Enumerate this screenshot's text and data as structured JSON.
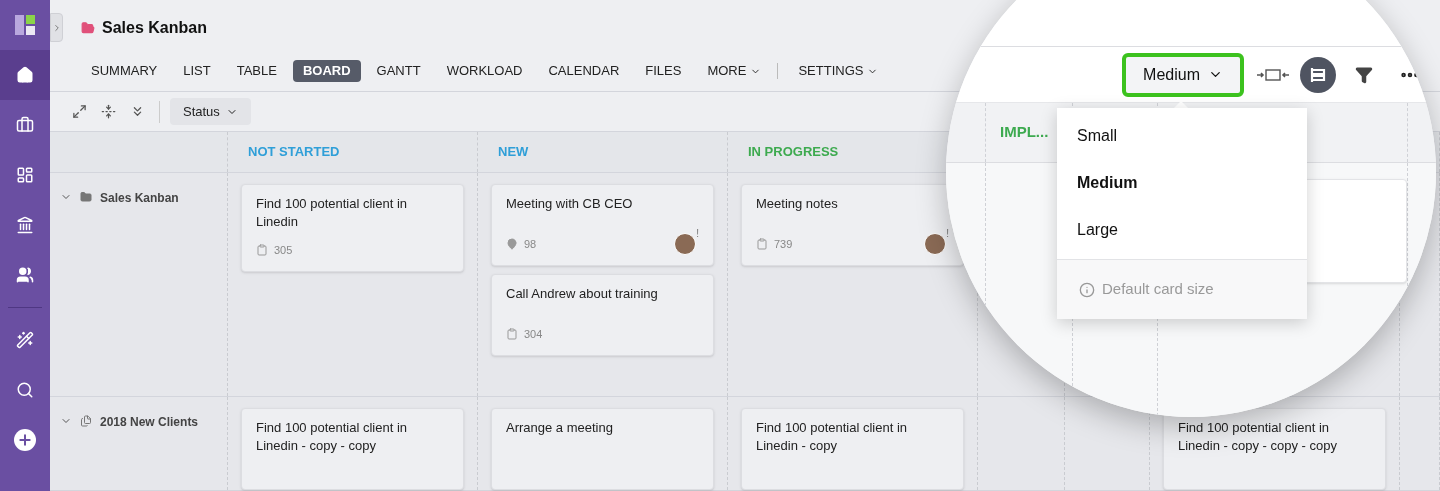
{
  "sidebar": {
    "items": [
      {
        "kind": "logo",
        "selected": false
      },
      {
        "kind": "home",
        "selected": true
      },
      {
        "kind": "briefcase",
        "selected": false
      },
      {
        "kind": "board",
        "selected": false
      },
      {
        "kind": "bank",
        "selected": false
      },
      {
        "kind": "people",
        "selected": false
      },
      {
        "kind": "wand",
        "selected": false
      },
      {
        "kind": "search",
        "selected": false
      },
      {
        "kind": "add",
        "selected": false
      }
    ]
  },
  "project": {
    "title": "Sales Kanban"
  },
  "tabs": [
    {
      "label": "SUMMARY",
      "selected": false,
      "kind": "tab"
    },
    {
      "label": "LIST",
      "selected": false,
      "kind": "tab"
    },
    {
      "label": "TABLE",
      "selected": false,
      "kind": "tab"
    },
    {
      "label": "BOARD",
      "selected": true,
      "kind": "tab"
    },
    {
      "label": "GANTT",
      "selected": false,
      "kind": "tab"
    },
    {
      "label": "WORKLOAD",
      "selected": false,
      "kind": "tab"
    },
    {
      "label": "CALENDAR",
      "selected": false,
      "kind": "tab"
    },
    {
      "label": "FILES",
      "selected": false,
      "kind": "tab"
    },
    {
      "label": "MORE",
      "selected": false,
      "kind": "menu"
    },
    {
      "label": "SETTINGS",
      "selected": false,
      "kind": "menu"
    }
  ],
  "toolbar": {
    "group_by": "Status"
  },
  "card_size": {
    "value": "Medium",
    "options": [
      {
        "label": "Small",
        "selected": false
      },
      {
        "label": "Medium",
        "selected": true
      },
      {
        "label": "Large",
        "selected": false
      }
    ],
    "footer": "Default card size"
  },
  "columns": [
    {
      "title": "NOT STARTED",
      "color": "#2f9fd8"
    },
    {
      "title": "NEW",
      "color": "#2f9fd8"
    },
    {
      "title": "IN PROGRESS",
      "color": "#3daa4f"
    },
    {
      "title": "IMPL...",
      "color": "#3daa4f"
    }
  ],
  "swimlanes": [
    {
      "title": "Sales Kanban",
      "kind": "folder",
      "expanded": true,
      "cells": [
        [
          {
            "title": "Find 100 potential client in Linedin",
            "kind": "task",
            "id": "305"
          }
        ],
        [
          {
            "title": "Meeting with CB CEO",
            "kind": "milestone",
            "id": "98",
            "avatar": true,
            "flag": "!"
          },
          {
            "title": "Call Andrew about training",
            "kind": "task",
            "id": "304"
          }
        ],
        [
          {
            "title": "Meeting notes",
            "kind": "task",
            "id": "739",
            "avatar": true,
            "flag": "!"
          }
        ],
        [],
        [],
        [
          {
            "kind": "blank"
          }
        ],
        []
      ]
    },
    {
      "title": "2018 New Clients",
      "kind": "list",
      "expanded": true,
      "cells": [
        [
          {
            "title": "Find 100 potential client in Linedin - copy - copy",
            "kind": "task"
          }
        ],
        [
          {
            "title": "Arrange a meeting",
            "kind": "task"
          }
        ],
        [
          {
            "title": "Find 100 potential client in Linedin - copy",
            "kind": "task"
          }
        ],
        [],
        [],
        [
          {
            "title": "Find 100 potential client in Linedin - copy - copy - copy",
            "kind": "task"
          }
        ],
        []
      ]
    }
  ]
}
